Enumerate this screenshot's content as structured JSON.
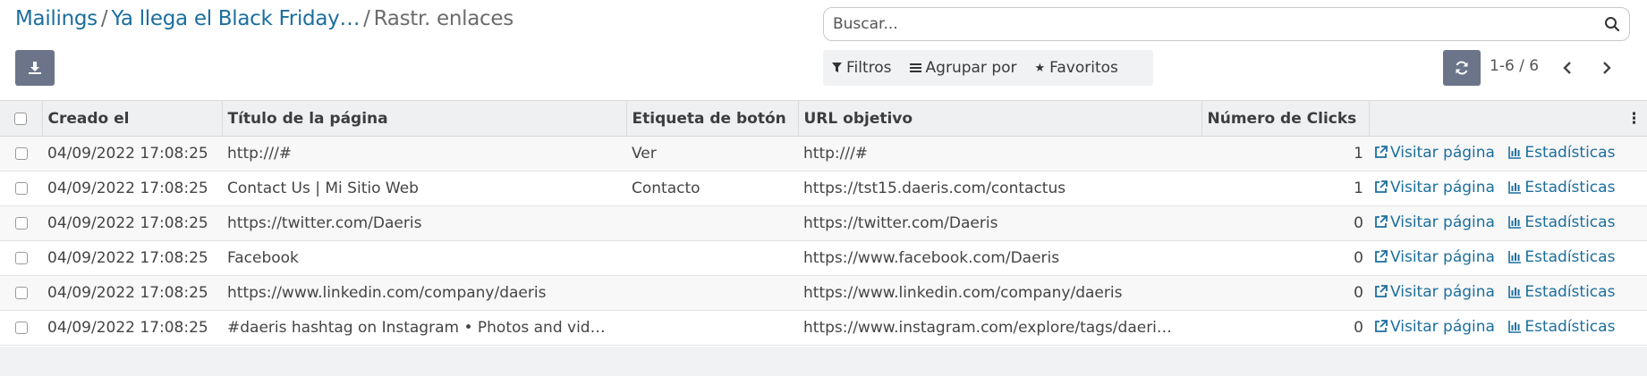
{
  "breadcrumb": {
    "root": "Mailings",
    "parent": "Ya llega el Black Friday…",
    "current": "Rastr. enlaces",
    "separator": "/"
  },
  "search": {
    "placeholder": "Buscar..."
  },
  "filters": {
    "filters_label": "Filtros",
    "group_label": "Agrupar por",
    "favorites_label": "Favoritos"
  },
  "pager": {
    "value": "1-6 / 6"
  },
  "table": {
    "columns": [
      "Creado el",
      "Título de la página",
      "Etiqueta de botón",
      "URL objetivo",
      "Número de Clicks"
    ],
    "visit_label": "Visitar página",
    "stats_label": "Estadísticas",
    "rows": [
      {
        "created": "04/09/2022 17:08:25",
        "title": "http:///#",
        "button": "Ver",
        "url": "http:///#",
        "clicks": "1"
      },
      {
        "created": "04/09/2022 17:08:25",
        "title": "Contact Us | Mi Sitio Web",
        "button": "Contacto",
        "url": "https://tst15.daeris.com/contactus",
        "clicks": "1"
      },
      {
        "created": "04/09/2022 17:08:25",
        "title": "https://twitter.com/Daeris",
        "button": "",
        "url": "https://twitter.com/Daeris",
        "clicks": "0"
      },
      {
        "created": "04/09/2022 17:08:25",
        "title": "Facebook",
        "button": "",
        "url": "https://www.facebook.com/Daeris",
        "clicks": "0"
      },
      {
        "created": "04/09/2022 17:08:25",
        "title": "https://www.linkedin.com/company/daeris",
        "button": "",
        "url": "https://www.linkedin.com/company/daeris",
        "clicks": "0"
      },
      {
        "created": "04/09/2022 17:08:25",
        "title": "#daeris hashtag on Instagram • Photos and vid…",
        "button": "",
        "url": "https://www.instagram.com/explore/tags/daeri…",
        "clicks": "0"
      }
    ]
  },
  "colors": {
    "accent": "#1c6e9e",
    "button_bg": "#6c7489",
    "header_bg": "#eef0f2"
  },
  "icons": [
    "download-icon",
    "search-icon",
    "filter-icon",
    "group-icon",
    "star-icon",
    "refresh-icon",
    "chevron-left-icon",
    "chevron-right-icon",
    "external-link-icon",
    "bar-chart-icon",
    "column-menu-icon"
  ]
}
